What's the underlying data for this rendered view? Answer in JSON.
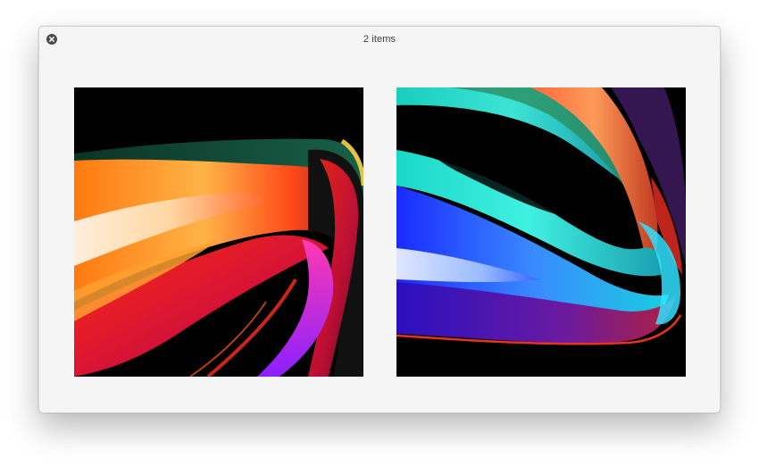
{
  "window": {
    "title": "2 items"
  },
  "icons": {
    "close": "close-circle-x-icon"
  },
  "colors": {
    "window_bg": "#f5f5f5",
    "close_button": "#4a4a4a",
    "image_bg": "#000000"
  }
}
